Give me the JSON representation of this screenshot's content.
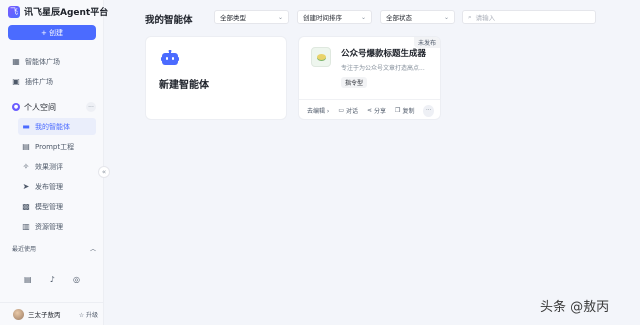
{
  "brand": {
    "logo_char": "飞",
    "name": "讯飞星辰Agent平台"
  },
  "sidebar": {
    "create_label": "+ 创建",
    "items": [
      {
        "label": "智能体广场",
        "icon": "grid-icon"
      },
      {
        "label": "插件广场",
        "icon": "plugin-icon"
      }
    ],
    "personal": {
      "label": "个人空间",
      "icon": "person-icon"
    },
    "sub_items": [
      {
        "label": "我的智能体",
        "icon": "folder-icon",
        "active": true
      },
      {
        "label": "Prompt工程",
        "icon": "prompt-icon"
      },
      {
        "label": "效果测评",
        "icon": "evaluate-icon"
      },
      {
        "label": "发布管理",
        "icon": "send-icon"
      },
      {
        "label": "模型管理",
        "icon": "model-icon"
      },
      {
        "label": "资源管理",
        "icon": "resource-icon"
      }
    ],
    "recent_label": "最近使用",
    "bottom_icons": [
      "doc-icon",
      "bell-icon",
      "wechat-icon"
    ],
    "user": {
      "name": "三太子敖丙",
      "upgrade_label": "☆ 升级"
    }
  },
  "main": {
    "title": "我的智能体",
    "filters": [
      {
        "selected": "全部类型"
      },
      {
        "selected": "创建时间排序"
      },
      {
        "selected": "全部状态"
      }
    ],
    "search": {
      "placeholder": "请输入"
    },
    "new_card": {
      "label": "新建智能体"
    },
    "agent_card": {
      "badge": "未发布",
      "title": "公众号爆款标题生成器",
      "desc": "专注于为公众号文章打造高点...",
      "tag": "指令型",
      "actions": [
        "去编辑 ›",
        "对话",
        "分享",
        "复制"
      ]
    }
  },
  "watermark": "头条 @敖丙",
  "colors": {
    "accent": "#4b6bff",
    "background": "#f3f5fa"
  }
}
